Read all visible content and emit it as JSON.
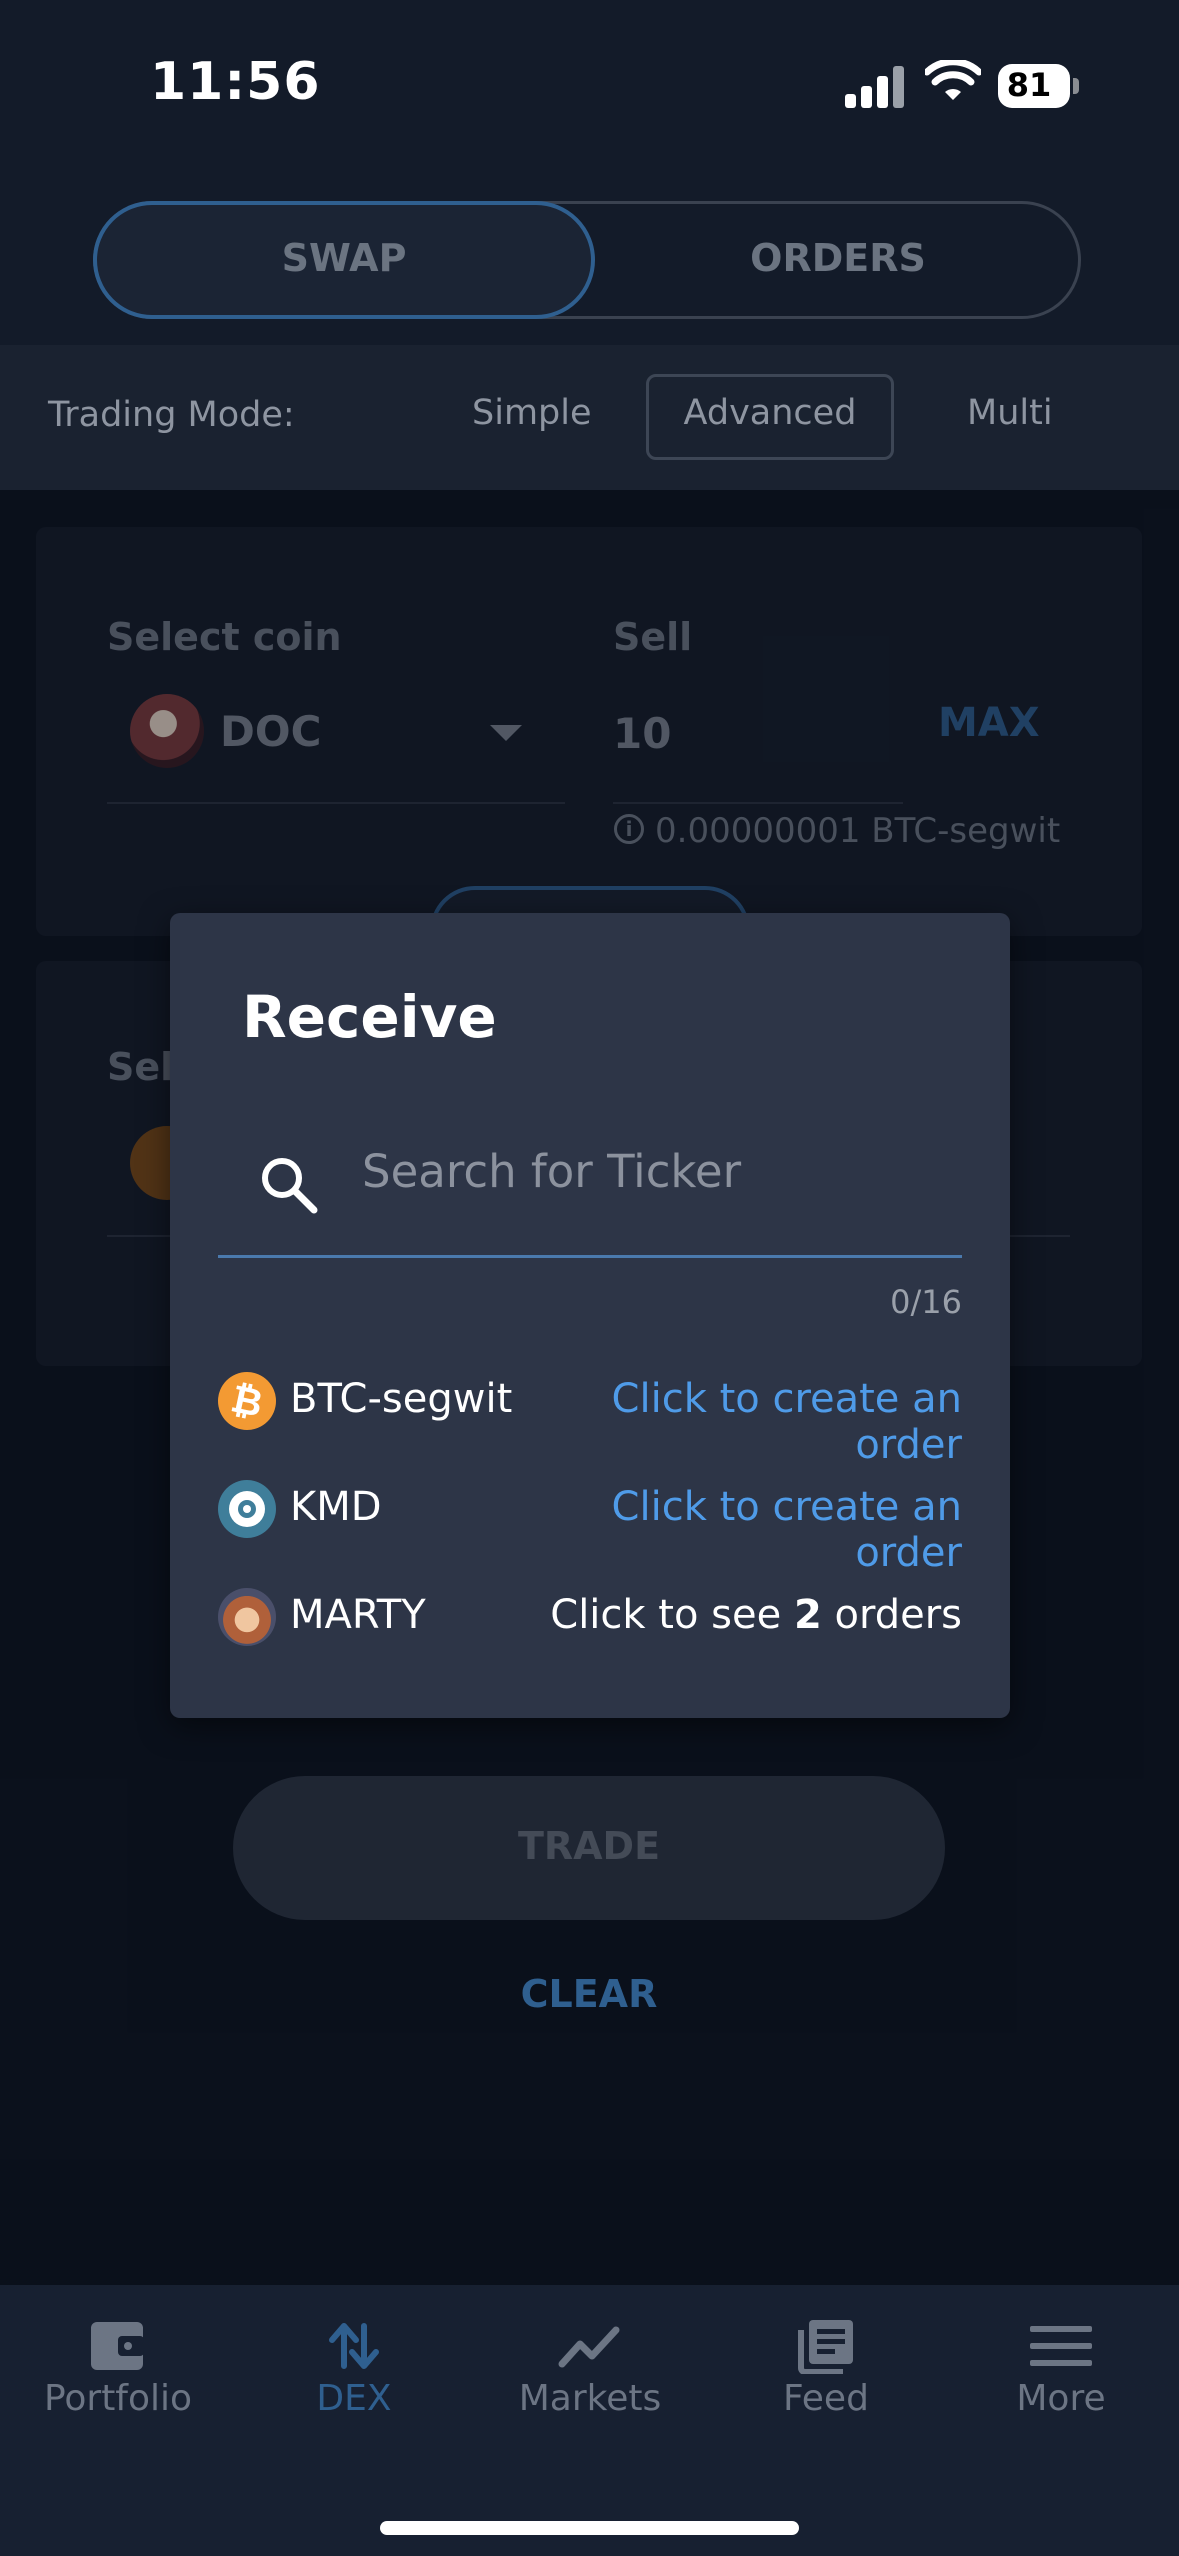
{
  "status_bar": {
    "time": "11:56",
    "battery": "81"
  },
  "tabs": {
    "swap": "SWAP",
    "orders": "ORDERS"
  },
  "trading_mode": {
    "label": "Trading Mode:",
    "options": [
      "Simple",
      "Advanced",
      "Multi"
    ],
    "selected": "Advanced"
  },
  "sell_card": {
    "select_coin_label": "Select coin",
    "coin": "DOC",
    "sell_label": "Sell",
    "amount": "10",
    "max_label": "MAX",
    "fee_hint": "0.00000001 BTC-segwit"
  },
  "receive_card": {
    "select_coin_label_partial": "Sel"
  },
  "modal": {
    "title": "Receive",
    "search_placeholder": "Search for Ticker",
    "counter": "0/16",
    "coins": [
      {
        "name": "BTC-segwit",
        "action": "Click to create an order",
        "icon": "bitcoin-icon",
        "color": "#f39a33"
      },
      {
        "name": "KMD",
        "action": "Click to create an order",
        "icon": "komodo-icon",
        "color": "#3f7e9a"
      },
      {
        "name": "MARTY",
        "action_prefix": "Click to see ",
        "action_count": "2",
        "action_suffix": " orders",
        "icon": "marty-avatar-icon",
        "color": "#b0603a"
      }
    ]
  },
  "buttons": {
    "trade": "TRADE",
    "clear": "CLEAR"
  },
  "bottom_nav": [
    {
      "label": "Portfolio",
      "icon": "wallet-icon",
      "active": false
    },
    {
      "label": "DEX",
      "icon": "swap-arrows-icon",
      "active": true
    },
    {
      "label": "Markets",
      "icon": "chart-line-icon",
      "active": false
    },
    {
      "label": "Feed",
      "icon": "newspaper-icon",
      "active": false
    },
    {
      "label": "More",
      "icon": "menu-icon",
      "active": false
    }
  ],
  "colors": {
    "accent": "#4f9be8",
    "active_tab_border": "#2f5f8f",
    "modal_bg": "#2d3547"
  }
}
